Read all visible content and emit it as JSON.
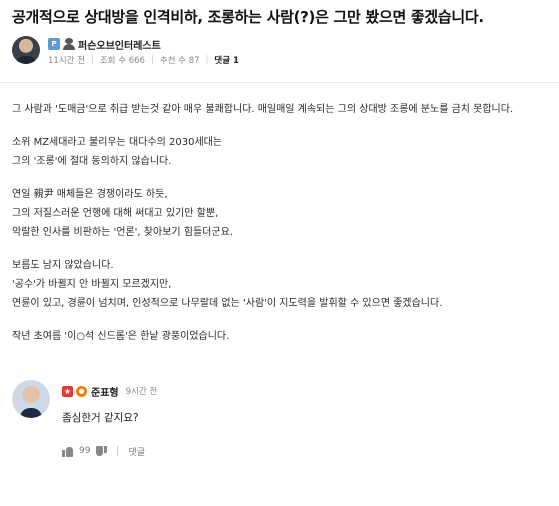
{
  "post": {
    "title": "공개적으로 상대방을 인격비하, 조롱하는 사람(?)은 그만 봤으면 좋겠습니다.",
    "author": {
      "badge_text": "P",
      "name": "퍼슨오브인터레스트"
    },
    "meta": {
      "time": "11시간 전",
      "views": "조회 수 666",
      "recommend": "추천 수 87",
      "comments": "댓글 1"
    },
    "body": [
      "그 사람과 '도매금'으로 취급 받는것 같아 매우 불쾌합니다. 매일매일 계속되는 그의 상대방 조롱에 분노를 금치 못합니다.",
      "",
      "소위 MZ세대라고 불리우는 대다수의 2030세대는",
      "그의 '조롱'에 절대 동의하지 않습니다.",
      "",
      "연일 親尹 매체들은 경쟁이라도 하듯,",
      "그의 저질스러운 언행에 대해 써대고 있기만 할뿐,",
      "악랄한 인사를 비판하는 '언론', 찾아보기 힘들더군요.",
      "",
      "보름도 남지 않았습니다.",
      "'공수'가 바뀔지 안 바뀔지 모르겠지만,",
      "연륜이 있고, 경륜이 넘치며, 인성적으로 나무랄데 없는 '사람'이 지도력을 발휘할 수 있으면 좋겠습니다.",
      "",
      "작년 초여름 '이○석 신드롬'은 한낱 광풍이었습니다."
    ]
  },
  "comment": {
    "name": "준표형",
    "time": "9시간 전",
    "text": "좀심한거 같지요?",
    "likes": "99",
    "reply_label": "댓글"
  }
}
